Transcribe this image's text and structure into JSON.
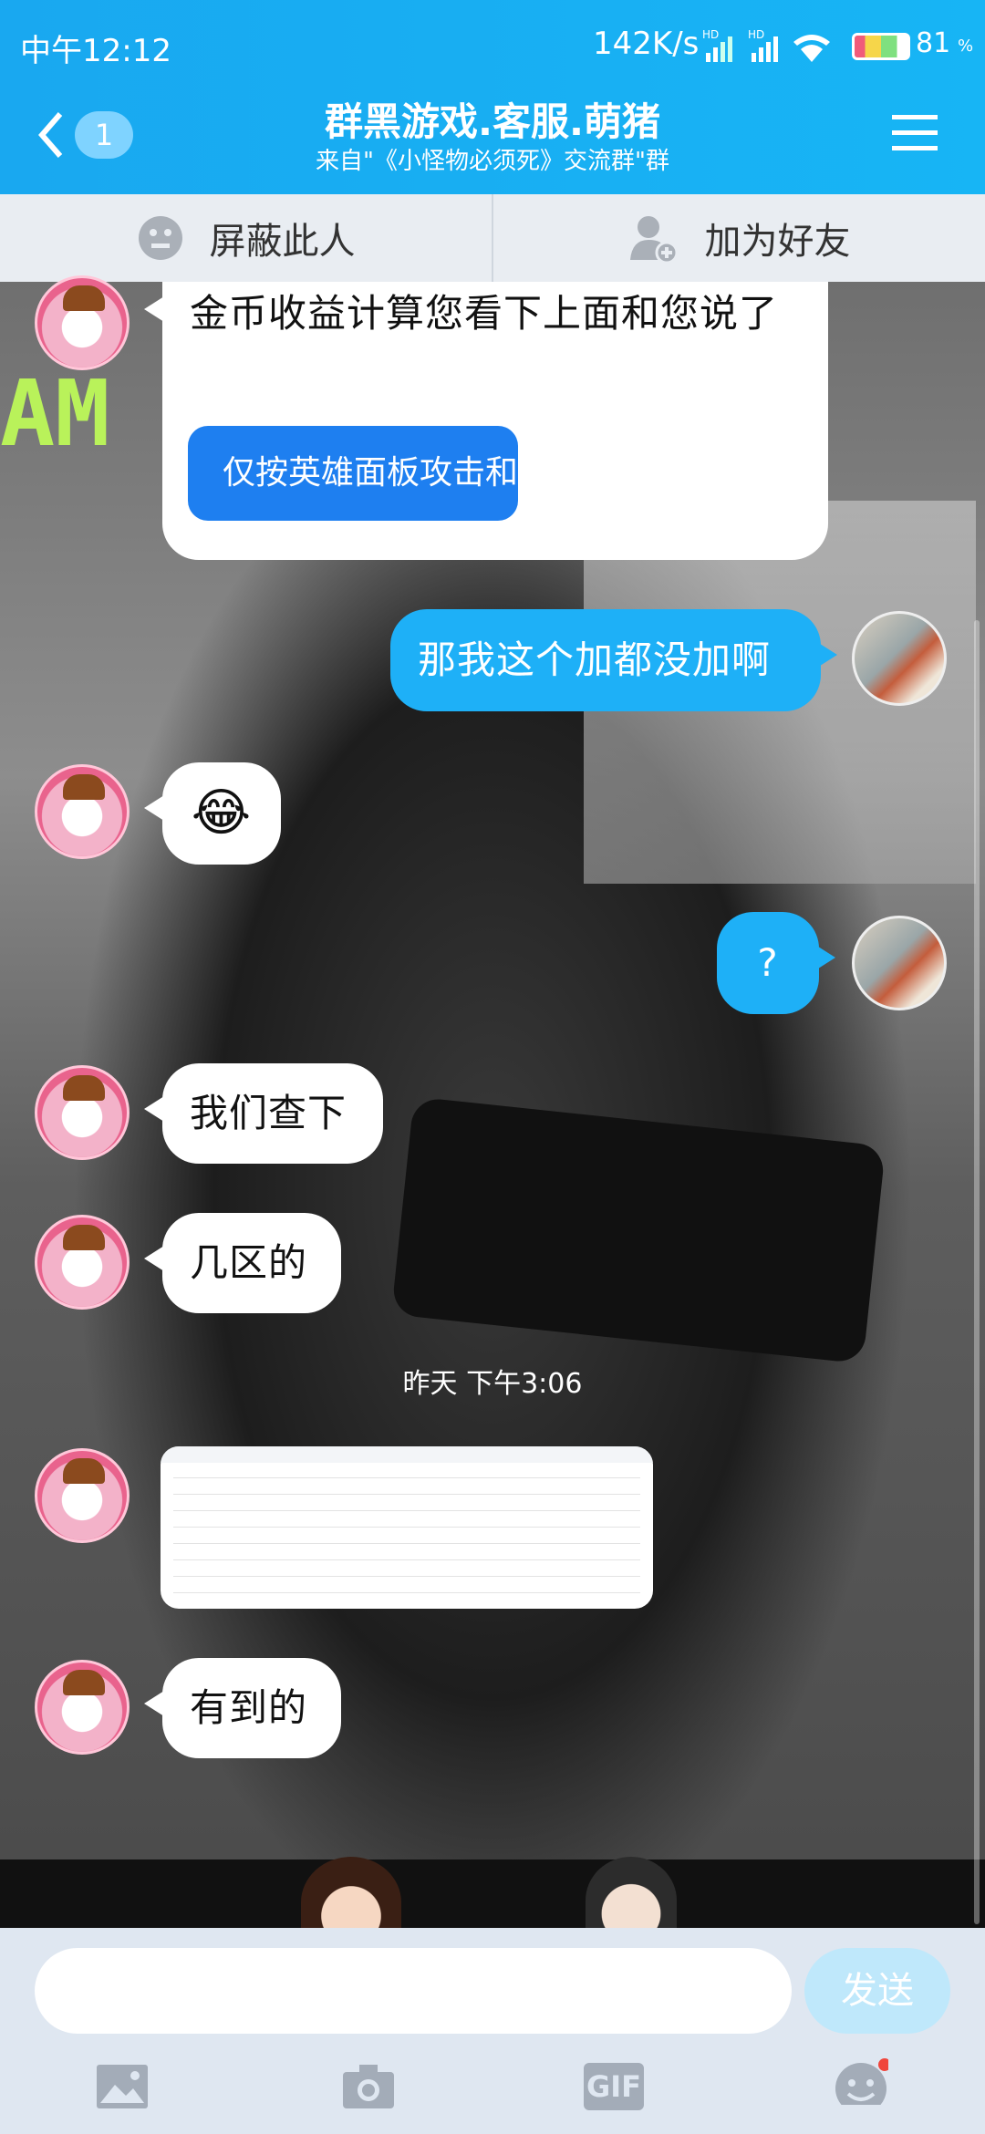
{
  "status_bar": {
    "time": "中午12:12",
    "network_speed": "142K/s",
    "battery": "81",
    "battery_unit": "%"
  },
  "header": {
    "title": "群黑游戏.客服.萌猪",
    "subtitle": "来自\"《小怪物必须死》交流群\"群",
    "unread_count": "1"
  },
  "actions": {
    "block_label": "屏蔽此人",
    "add_friend_label": "加为好友"
  },
  "messages": {
    "m1_text": "金币收益计算您看下上面和您说了",
    "m1_button": "仅按英雄面板攻击和",
    "m2_text": "那我这个加都没加啊",
    "m3_emoji": "😂",
    "m4_text": "?",
    "m5_text": "我们查下",
    "m6_text": "几区的",
    "time_label": "昨天 下午3:06",
    "m8_text": "有到的"
  },
  "input": {
    "placeholder": "",
    "send_label": "发送"
  },
  "toolbar": {
    "gif_label": "GIF"
  },
  "colors": {
    "header": "#19a8f0",
    "my_bubble": "#1eb0f7",
    "send_disabled": "#bfe8fb"
  }
}
